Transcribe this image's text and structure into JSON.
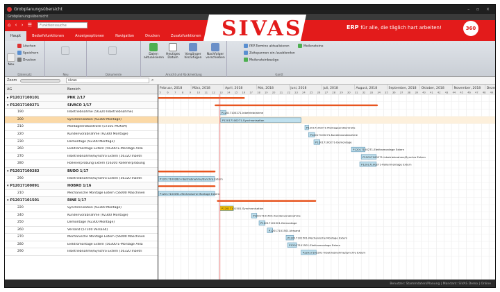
{
  "window": {
    "title": "Grobplanungsübersicht",
    "doc_title": "Grobplanungsübersicht",
    "controls": "–  ▫  ×"
  },
  "brand": {
    "logo": "SIVAS.",
    "slogan_bold": "ERP",
    "slogan_rest": "für alle, die täglich hart arbeiten!",
    "badge": "360"
  },
  "quick_access": {
    "icons": "⌂ ‹ › ☰",
    "search_placeholder": "Funktionssuche"
  },
  "menu_tabs": [
    "Haupt",
    "Bedarfsfunktionen",
    "Anzeigeoptionen",
    "Navigation",
    "Drucken",
    "Zusatzfunktionen"
  ],
  "ribbon": {
    "groups": [
      "Datensatz",
      "Neu",
      "Dokumente",
      "Ansicht und Rückmeldung",
      "Gantt"
    ],
    "new_label": "Neu",
    "record_items": [
      "Löschen",
      "Speichern",
      "Drucken"
    ],
    "view_buttons": [
      "Daten aktualisieren",
      "Heutiges Datum",
      "Vorgänger hinzufügen",
      "Nachfolger verschieben"
    ],
    "gantt_items": [
      "PEP-Termine aktualisieren",
      "Zeitspannen ein-/ausblenden",
      "Meilensteinbezüge",
      "Meilensteine"
    ]
  },
  "filter": {
    "zoom_label": "Zoom",
    "search_value": "sivas"
  },
  "columns": {
    "ag": "AG",
    "bereich": "Bereich"
  },
  "rows": [
    {
      "ag": "P12017100101",
      "bereich": "PNK 2/17",
      "type": "group",
      "toggle": "▸"
    },
    {
      "ag": "P12017100271",
      "bereich": "SIVACO 1/17",
      "type": "group",
      "toggle": "▾"
    },
    {
      "ag": "190",
      "bereich": "Inbetriebnahme (56320 Inbetriebnahme)",
      "type": "row"
    },
    {
      "ag": "200",
      "bereich": "Synchronisation (92300 Montage)",
      "type": "sel"
    },
    {
      "ag": "210",
      "bereich": "Montageendkontrolle (57301 MUKVA)",
      "type": "row"
    },
    {
      "ag": "220",
      "bereich": "Kundenvorabnahme (92300 Montage)",
      "type": "row"
    },
    {
      "ag": "230",
      "bereich": "Demontage (92300 Montage)",
      "type": "row"
    },
    {
      "ag": "260",
      "bereich": "Elektromontage Extern (56300 E-Montage Anla",
      "type": "row"
    },
    {
      "ag": "270",
      "bereich": "Inbetriebnahme/Synchro Extern (56320 Inbetri",
      "type": "row"
    },
    {
      "ag": "280",
      "bereich": "Rollenerprobung Extern (56200 Rollenerprobung",
      "type": "row"
    },
    {
      "ag": "P12017100282",
      "bereich": "BUDO 1/17",
      "type": "group",
      "toggle": "▾"
    },
    {
      "ag": "290",
      "bereich": "Inbetriebnahme/Synchro Extern (56320 Inbetri",
      "type": "row"
    },
    {
      "ag": "P12017100091",
      "bereich": "HÖBRO 1/16",
      "type": "group",
      "toggle": "▾"
    },
    {
      "ag": "210",
      "bereich": "Mechanische Montage Extern (56000 Maschinen",
      "type": "row"
    },
    {
      "ag": "P12017101501",
      "bereich": "RINE 1/17",
      "type": "group",
      "toggle": "▾"
    },
    {
      "ag": "220",
      "bereich": "Synchronisation (92300 Montage)",
      "type": "row"
    },
    {
      "ag": "240",
      "bereich": "Kundenvorabnahme (92300 Montage)",
      "type": "row"
    },
    {
      "ag": "250",
      "bereich": "Demontage (92300 Montage)",
      "type": "row"
    },
    {
      "ag": "260",
      "bereich": "Versand (57100 Versand)",
      "type": "row"
    },
    {
      "ag": "270",
      "bereich": "Mechanische Montage Extern (56000 Maschinen",
      "type": "row"
    },
    {
      "ag": "280",
      "bereich": "Elektromontage Extern (56300 E-Montage Anla",
      "type": "row"
    },
    {
      "ag": "290",
      "bereich": "Inbetriebnahme/Synchro Extern (56320 Inbetri",
      "type": "row"
    }
  ],
  "timeline": {
    "months": [
      "Februar, 2018",
      "März, 2018",
      "April, 2018",
      "Mai, 2018",
      "Juni, 2018",
      "Juli, 2018",
      "August, 2018",
      "September, 2018",
      "Oktober, 2018",
      "November, 2018",
      "Dezember"
    ],
    "weeks": [
      "5",
      "6",
      "7",
      "8",
      "9",
      "10",
      "11",
      "12",
      "13",
      "14",
      "15",
      "16",
      "17",
      "18",
      "19",
      "20",
      "21",
      "22",
      "23",
      "24",
      "25",
      "26",
      "27",
      "28",
      "29",
      "30",
      "31",
      "32",
      "33",
      "34",
      "35",
      "36",
      "37",
      "38",
      "39",
      "40",
      "41",
      "42",
      "43",
      "44",
      "45",
      "46",
      "47",
      "48",
      "49"
    ],
    "today_week": 13.2
  },
  "bars": [
    {
      "row": 0,
      "start": 5,
      "end": 16.5,
      "style": "summary"
    },
    {
      "row": 1,
      "start": 12.5,
      "end": 34.2,
      "style": "summary"
    },
    {
      "row": 2,
      "start": 13.2,
      "end": 14,
      "style": "bar",
      "label": "P12017100271-Inbetriebnahme"
    },
    {
      "row": 3,
      "start": 13.3,
      "end": 24,
      "style": "bar",
      "label": "P12017100271-Synchronisation"
    },
    {
      "row": 4,
      "start": 24.5,
      "end": 25,
      "style": "bar",
      "label": "P12017100271-Montageendkontrolle"
    },
    {
      "row": 5,
      "start": 25,
      "end": 25.8,
      "style": "bar",
      "label": "P12017100271-Kundenvorabnahme"
    },
    {
      "row": 6,
      "start": 25.7,
      "end": 26.5,
      "style": "bar",
      "label": "P12017100271-Demontage"
    },
    {
      "row": 7,
      "start": 30.7,
      "end": 32.5,
      "style": "bar",
      "label": "P12017100271-Elektromontage Extern"
    },
    {
      "row": 8,
      "start": 32,
      "end": 34,
      "style": "bar",
      "label": "P12017100271-Inbetriebnahme/Synchro Extern"
    },
    {
      "row": 9,
      "start": 31.8,
      "end": 34,
      "style": "bar",
      "label": "P12017100271-Rollenmontage Extern"
    },
    {
      "row": 10,
      "start": 5,
      "end": 12.6,
      "style": "summary"
    },
    {
      "row": 11,
      "start": 5,
      "end": 12.5,
      "style": "bar",
      "label": "P12017100282-Inbetriebnahme/Synchro Extern"
    },
    {
      "row": 12,
      "start": 5,
      "end": 12.6,
      "style": "summary"
    },
    {
      "row": 13,
      "start": 5,
      "end": 12.5,
      "style": "bar",
      "label": "P12017100091-Mechanische Montage Extern"
    },
    {
      "row": 14,
      "start": 12.8,
      "end": 26,
      "style": "summary"
    },
    {
      "row": 15,
      "start": 13.2,
      "end": 15,
      "style": "yellow",
      "label": "P12017101501-Synchronisation"
    },
    {
      "row": 16,
      "start": 17.4,
      "end": 18.1,
      "style": "bar",
      "label": "P12017101501-Kundenvorabnahme"
    },
    {
      "row": 17,
      "start": 18.4,
      "end": 19.2,
      "style": "bar",
      "label": "P12017101501-Demontage"
    },
    {
      "row": 18,
      "start": 19.5,
      "end": 20.2,
      "style": "bar",
      "label": "P12017101501-Versand"
    },
    {
      "row": 19,
      "start": 22,
      "end": 23,
      "style": "bar",
      "label": "P12017101501-Mechanische Montage Extern"
    },
    {
      "row": 20,
      "start": 22.2,
      "end": 23.4,
      "style": "bar",
      "label": "P12017101501-Elektromontage Extern"
    },
    {
      "row": 21,
      "start": 24,
      "end": 26,
      "style": "bar",
      "label": "P12017101501-Inbetriebnahme/Synchro Extern"
    }
  ],
  "status": {
    "text": "Benutzer: Stammdaten/Planung | Mandant: SIVAS Demo | Online"
  },
  "colors": {
    "brand_red": "#e31b1b",
    "bar_fill": "#bfe0ee",
    "bar_stroke": "#5a90b0",
    "summary": "#e8541e",
    "today_line": "#e35a5a",
    "selected_row": "#fbd9a7",
    "yellow": "#f7c200"
  }
}
